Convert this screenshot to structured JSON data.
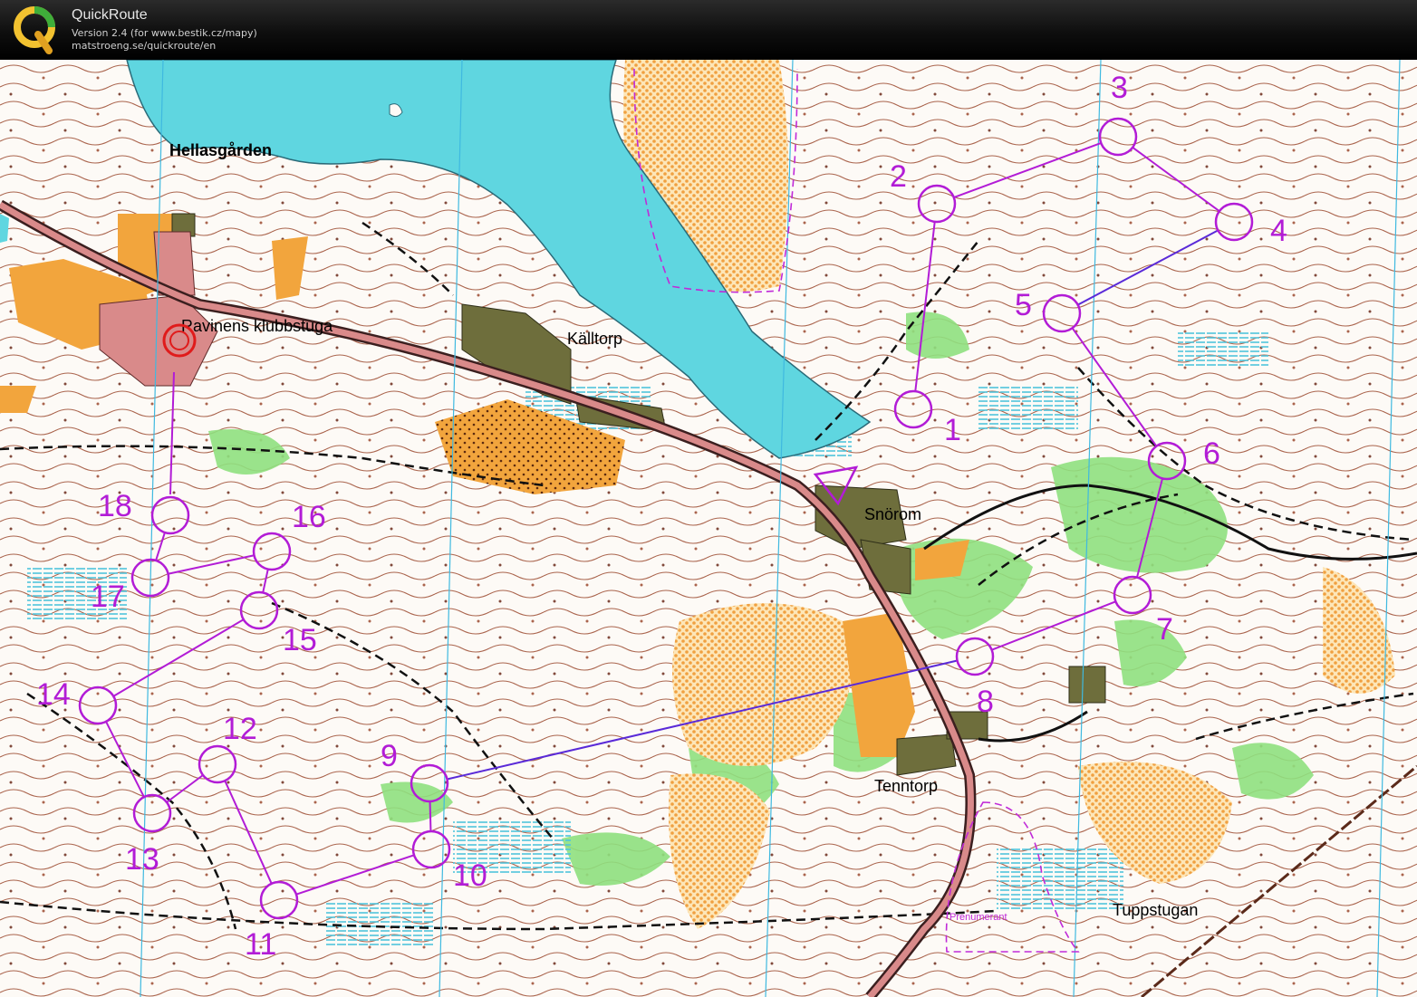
{
  "app": {
    "title": "QuickRoute",
    "version": "Version 2.4  (for www.bestik.cz/mapy)",
    "url": "matstroeng.se/quickroute/en",
    "logo_letter": "Q"
  },
  "colors": {
    "header_bg": "#111111",
    "course": "#b21cd6",
    "course_blue": "#5a2ad8",
    "water": "#5fd6e0",
    "open_land": "#f2a53d",
    "forest_green": "#8fe07f",
    "marsh_blue": "#77d6e4",
    "built_area": "#6e6e3c",
    "road_fill": "#d98a8a",
    "contour": "#9b4a2f",
    "start_red": "#e01b1b"
  },
  "map": {
    "place_names": [
      {
        "id": "hellasgarden",
        "text": "Hellasgården",
        "bold": true
      },
      {
        "id": "ravinens",
        "text": "Ravinens klubbstuga",
        "bold": false
      },
      {
        "id": "kalltorp",
        "text": "Källtorp",
        "bold": false
      },
      {
        "id": "snorom",
        "text": "Snörom",
        "bold": false
      },
      {
        "id": "tenntorp",
        "text": "Tenntorp",
        "bold": false
      },
      {
        "id": "tuppstugan",
        "text": "Tuppstugan",
        "bold": false
      }
    ],
    "small_label": "Prenumerant",
    "controls": [
      {
        "number": "1"
      },
      {
        "number": "2"
      },
      {
        "number": "3"
      },
      {
        "number": "4"
      },
      {
        "number": "5"
      },
      {
        "number": "6"
      },
      {
        "number": "7"
      },
      {
        "number": "8"
      },
      {
        "number": "9"
      },
      {
        "number": "10"
      },
      {
        "number": "11"
      },
      {
        "number": "12"
      },
      {
        "number": "13"
      },
      {
        "number": "14"
      },
      {
        "number": "15"
      },
      {
        "number": "16"
      },
      {
        "number": "17"
      },
      {
        "number": "18"
      }
    ]
  }
}
